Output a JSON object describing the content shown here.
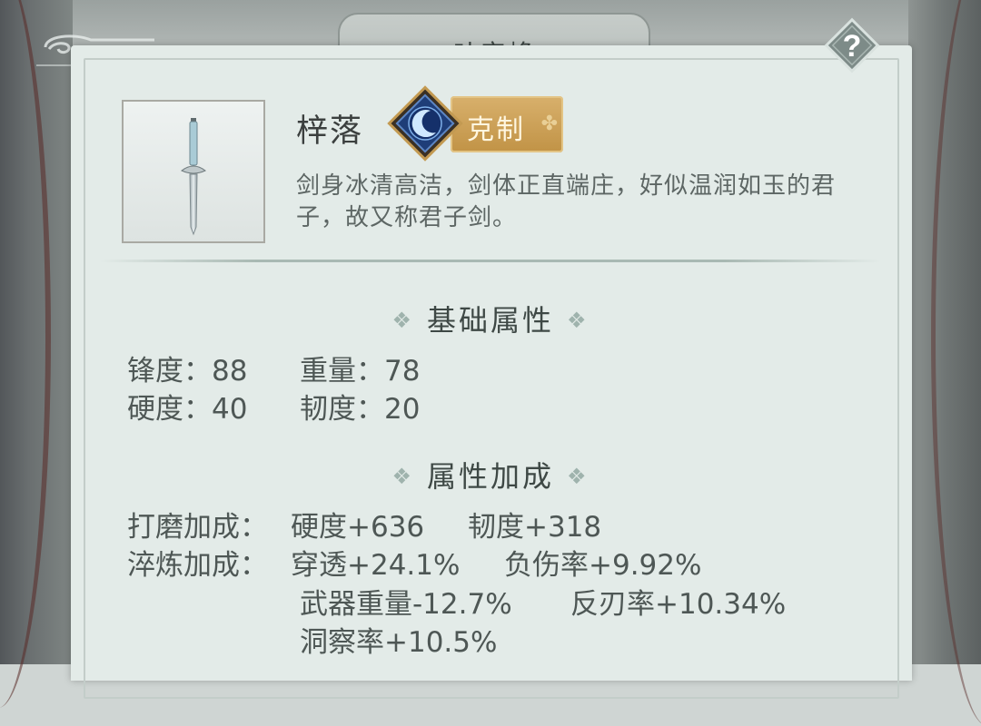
{
  "header": {
    "title": "叶安峰"
  },
  "help": {
    "icon": "question-mark-icon",
    "label": "?"
  },
  "item": {
    "icon": "sword-icon",
    "name": "梓落",
    "badge_icon": "crescent-moon-icon",
    "badge_label": "克制",
    "description": "剑身冰清高洁，剑体正直端庄，好似温润如玉的君子，故又称君子剑。"
  },
  "base_attributes": {
    "title": "基础属性",
    "ornament": "❖",
    "rows": [
      {
        "label": "锋度：88",
        "label2": "重量：78"
      },
      {
        "label": "硬度：40",
        "label2": "韧度：20"
      }
    ]
  },
  "bonus_attributes": {
    "title": "属性加成",
    "ornament": "❖",
    "grind_label": "打磨加成：",
    "grind_values": [
      "硬度+636",
      "韧度+318"
    ],
    "temper_label": "淬炼加成：",
    "temper_values": [
      "穿透+24.1%",
      "负伤率+9.92%",
      "武器重量-12.7%",
      "反刃率+10.34%",
      "洞察率+10.5%"
    ]
  },
  "colors": {
    "panel": "#e3ebe8",
    "badge": "#c9a056",
    "emblem": "#1f3f7a"
  }
}
